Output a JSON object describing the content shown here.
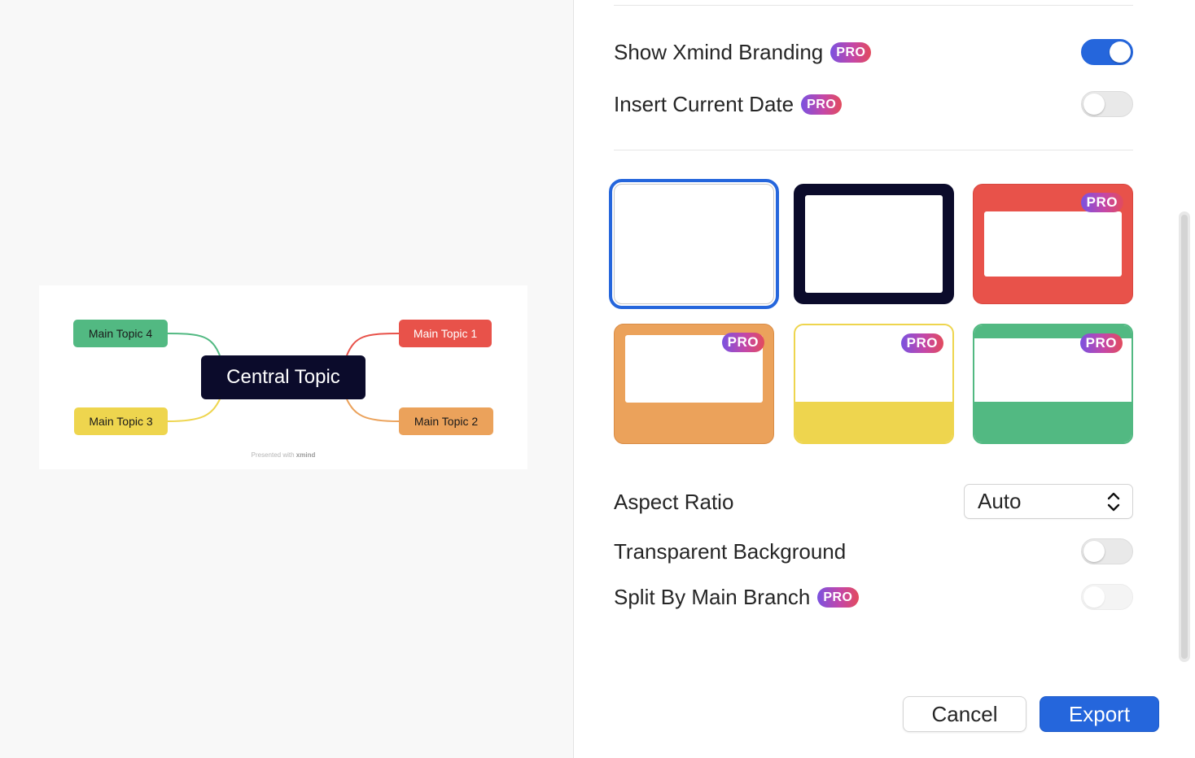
{
  "preview": {
    "central_topic": "Central Topic",
    "main_topics": [
      "Main Topic 1",
      "Main Topic 2",
      "Main Topic 3",
      "Main Topic 4"
    ],
    "branding_prefix": "Presented with",
    "branding_brand": "xmind"
  },
  "settings": {
    "show_branding": {
      "label": "Show Xmind Branding",
      "pro": "PRO",
      "enabled": true
    },
    "insert_date": {
      "label": "Insert Current Date",
      "pro": "PRO",
      "enabled": false
    },
    "themes": [
      {
        "id": "white",
        "selected": true,
        "pro": false
      },
      {
        "id": "dark",
        "selected": false,
        "pro": false
      },
      {
        "id": "red",
        "selected": false,
        "pro": true,
        "pro_label": "PRO"
      },
      {
        "id": "orange",
        "selected": false,
        "pro": true,
        "pro_label": "PRO"
      },
      {
        "id": "yellow",
        "selected": false,
        "pro": true,
        "pro_label": "PRO"
      },
      {
        "id": "green",
        "selected": false,
        "pro": true,
        "pro_label": "PRO"
      }
    ],
    "aspect_ratio": {
      "label": "Aspect Ratio",
      "value": "Auto"
    },
    "transparent_background": {
      "label": "Transparent Background",
      "enabled": false
    },
    "split_by_branch": {
      "label": "Split By Main Branch",
      "pro": "PRO",
      "enabled": false,
      "disabled": true
    }
  },
  "footer": {
    "cancel_label": "Cancel",
    "export_label": "Export"
  },
  "colors": {
    "accent": "#2566dc",
    "central": "#0b0b2b",
    "topic_red": "#e8524a",
    "topic_orange": "#eba25b",
    "topic_yellow": "#eed54e",
    "topic_green": "#52b982"
  }
}
